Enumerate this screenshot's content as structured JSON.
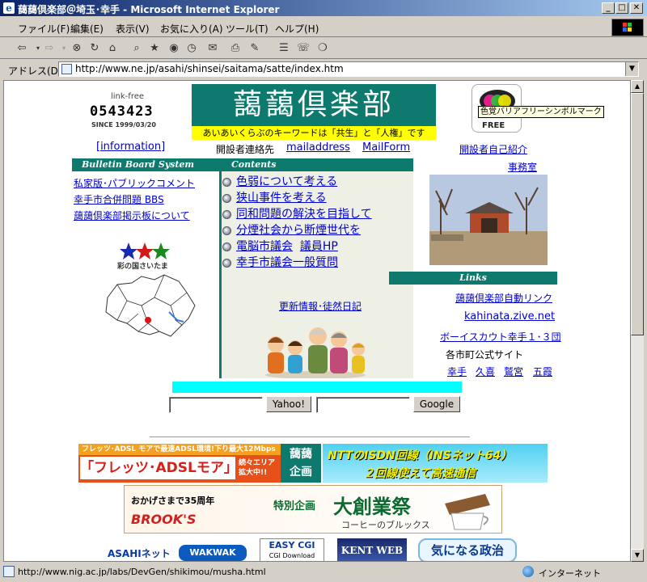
{
  "window": {
    "title": "藹藹倶楽部＠埼玉･幸手 - Microsoft Internet Explorer"
  },
  "menu": [
    "ファイル(F)",
    "編集(E)",
    "表示(V)",
    "お気に入り(A)",
    "ツール(T)",
    "ヘルプ(H)"
  ],
  "address": {
    "label": "アドレス(D)",
    "url": "http://www.ne.jp/asahi/shinsei/saitama/satte/index.htm"
  },
  "header": {
    "counter_label": "link-free",
    "counter_value": "0543423",
    "since": "SINCE 1999/03/20",
    "site_title": "藹藹倶楽部",
    "tagline": "あいあいくらぶのキーワードは「共生」と「人権」です",
    "barrier_free_caption": "色覚バリアフリーシンボルマーク",
    "barrier_free_label": "FREE"
  },
  "contact": {
    "information": "[information]",
    "label": "開設者連絡先",
    "mailaddress": "mailaddress",
    "mailform": "MailForm",
    "self_intro": "開設者自己紹介",
    "office": "事務室"
  },
  "bbs": {
    "header": "Bulletin Board System",
    "items": [
      "私家版･パブリックコメント",
      "幸手市合併問題 BBS",
      "藹藹倶楽部掲示板について"
    ]
  },
  "saitama": {
    "label": "彩の国さいたま"
  },
  "contents": {
    "header": "Contents",
    "items": [
      [
        "色弱について考える"
      ],
      [
        "狭山事件を考える"
      ],
      [
        "同和問題の解決を目指して"
      ],
      [
        "分煙社会から断煙世代を"
      ],
      [
        "電脳市議会",
        "議員HP"
      ],
      [
        "幸手市議会一般質問"
      ]
    ],
    "diary": "更新情報･徒然日記"
  },
  "links": {
    "header": "Links",
    "auto_link": "藹藹倶楽部自動リンク",
    "zive": "kahinata.zive.net",
    "scout": "ボーイスカウト幸手１･３団",
    "city_sites_label": "各市町公式サイト",
    "cities": [
      "幸手",
      "久喜",
      "鷲宮",
      "五霞"
    ]
  },
  "search": {
    "yahoo": "Yahoo!",
    "google": "Google"
  },
  "banners": {
    "flets_top": "フレッツ･ADSL モアで最速ADSL環境!下り最大12Mbps",
    "flets_main": "「フレッツ･ADSLモア」",
    "flets_side": "続々エリア拡大中!!",
    "aiai_logo": "藹藹企画",
    "ntt_line1": "NTTのISDN回線（INSネット64）",
    "ntt_line2": "２回線使えて高速通信",
    "brooks_anniv": "おかげさまで35周年",
    "brooks_logo": "BROOK'S",
    "brooks_special": "特別企画",
    "brooks_big": "大創業祭",
    "brooks_sub": "コーヒーのブルックス",
    "asahi": "ASAHIネット",
    "wakwak": "WAKWAK",
    "easycgi": "EASY CGI",
    "easycgi_sub": "CGI Download",
    "kent": "KENT WEB",
    "seiji": "気になる政治"
  },
  "status": {
    "url": "http://www.nig.ac.jp/labs/DevGen/shikimou/musha.html",
    "zone": "インターネット"
  }
}
